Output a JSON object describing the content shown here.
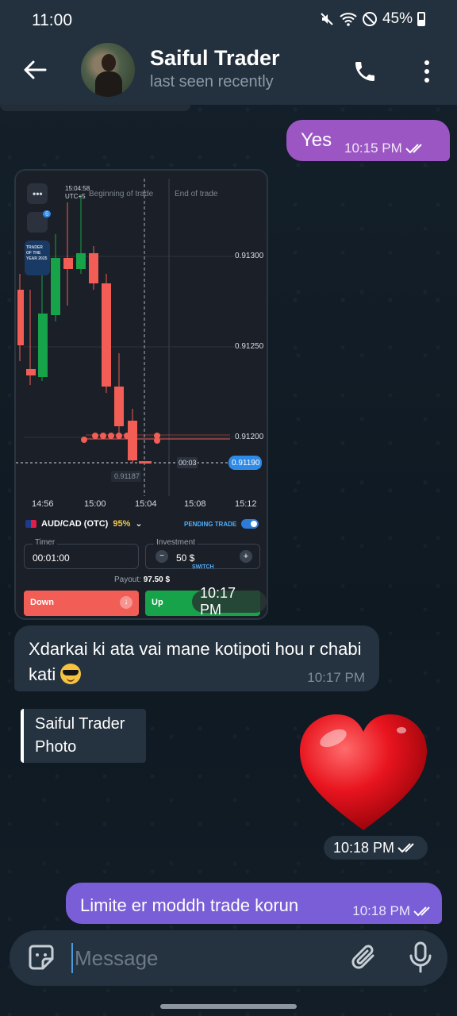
{
  "status_bar": {
    "time": "11:00",
    "battery": "45%"
  },
  "header": {
    "contact_name": "Saiful Trader",
    "contact_status": "last seen recently"
  },
  "messages": {
    "out_1": {
      "text": "Yes",
      "time": "10:15 PM"
    },
    "photo": {
      "time": "10:17 PM",
      "trade": {
        "chart_time": "15:04:58",
        "chart_sub": "UTC+5",
        "beginning_label": "Beginning of trade",
        "end_label": "End of trade",
        "badge_count": "6",
        "trader_badge": "TRADER OF THE YEAR 2025",
        "prices": [
          "0.91300",
          "0.91250",
          "0.91200"
        ],
        "current_price": "0.91190",
        "countdown": "00:03",
        "ref_price": "0.91187",
        "times": [
          "14:56",
          "15:00",
          "15:04",
          "15:08",
          "15:12"
        ],
        "asset": "AUD/CAD (OTC)",
        "payout_pct": "95%",
        "pending": "PENDING TRADE",
        "timer_label": "Timer",
        "timer_value": "00:01:00",
        "investment_label": "Investment",
        "investment_value": "50 $",
        "switch_label": "SWITCH",
        "payout_label": "Payout:",
        "payout_value": "97.50 $",
        "down_label": "Down",
        "up_label": "Up"
      }
    },
    "in_1": {
      "text": "Xdarkai ki ata vai mane kotipoti hou r chabi kati",
      "time": "10:17 PM"
    },
    "reply_preview": {
      "name": "Saiful Trader",
      "sub": "Photo"
    },
    "heart": {
      "time": "10:18 PM"
    },
    "out_2": {
      "text": "Limite er moddh trade korun",
      "time": "10:18 PM"
    }
  },
  "input": {
    "placeholder": "Message"
  },
  "colors": {
    "outgoing_bubble": "#7a5ed8",
    "incoming_bubble": "#25323f",
    "header": "#23303d",
    "accent": "#4f9ae0"
  }
}
